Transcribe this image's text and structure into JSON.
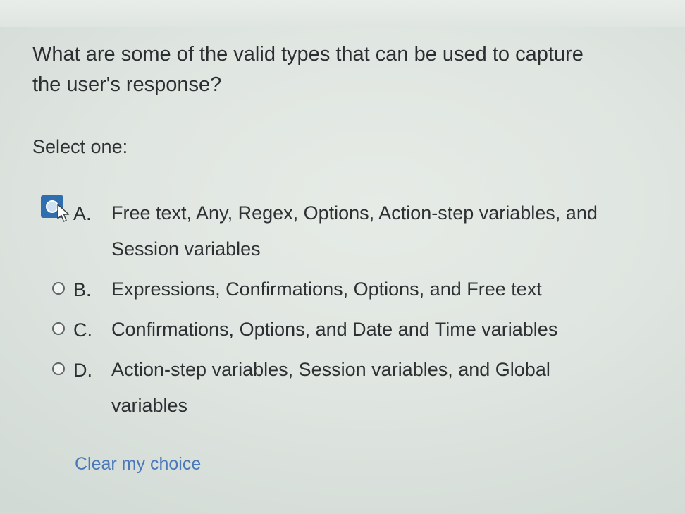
{
  "question": {
    "line1": "What are some of the valid types that can be used to capture",
    "line2": "the user's response?"
  },
  "prompt": "Select one:",
  "options": [
    {
      "letter": "A.",
      "text": "Free text, Any, Regex, Options, Action-step variables, and Session variables",
      "state": "hovered"
    },
    {
      "letter": "B.",
      "text": "Expressions, Confirmations, Options, and Free text",
      "state": "unselected"
    },
    {
      "letter": "C.",
      "text": "Confirmations, Options, and Date and Time variables",
      "state": "unselected"
    },
    {
      "letter": "D.",
      "text": "Action-step variables, Session variables, and Global variables",
      "state": "unselected"
    }
  ],
  "clear_link": "Clear my choice",
  "colors": {
    "text": "#2c2f31",
    "link": "#4a78b8",
    "radio_focus": "#2f6fb0",
    "background": "#dde3de"
  },
  "icons": {
    "cursor": "mouse-pointer-icon"
  }
}
